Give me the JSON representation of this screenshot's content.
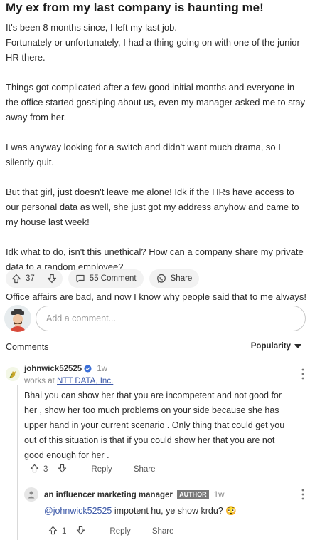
{
  "post": {
    "title": "My ex from my last company is haunting me!",
    "paragraphs": [
      "It's been 8 months since, I left my last job.",
      "Fortunately or unfortunately, I had a thing going on with one of the junior HR there.",
      "Things got complicated after a few good initial months and everyone in the office started gossiping about us, even my manager asked me to stay away from her.",
      "I was anyway looking for a switch and didn't want much drama, so I silently quit.",
      "But that girl, just doesn't leave me alone! Idk if the HRs have access to our personal data as well, she just got my address anyhow and came to my house last week!",
      "Idk what to do, isn't this unethical? How can a company share my private data to a random employee?",
      "Office affairs are bad, and now I know why people said that to me always!"
    ],
    "upvotes": "37",
    "comment_label": "55 Comment",
    "share_label": "Share"
  },
  "add_comment": {
    "placeholder": "Add a comment..."
  },
  "comments_section": {
    "title": "Comments",
    "sort_label": "Popularity"
  },
  "comment": {
    "author": "johnwick52525",
    "time": "1w",
    "works_at_prefix": "works at",
    "company": "NTT DATA, Inc.",
    "lines": [
      "Bhai you can show her that you are incompetent and not good for",
      "her , show her too much problems on your side because she has",
      "upper hand in your current scenario . Only thing that could get you",
      "out of this situation is that if you could show her that you are not",
      "good enough for her ."
    ],
    "upvotes": "3",
    "reply_label": "Reply",
    "share_label": "Share"
  },
  "reply": {
    "author": "an influencer marketing manager",
    "badge": "AUTHOR",
    "time": "1w",
    "mention": "@johnwick52525",
    "text": " impotent hu, ye show krdu?",
    "emoji": "😳",
    "upvotes": "1",
    "reply_label": "Reply",
    "share_label": "Share"
  },
  "colors": {
    "link": "#3b58a8",
    "pill_bg": "#f2f2f2",
    "badge_bg": "#7a7a7a",
    "verified": "#3b6fd8"
  }
}
